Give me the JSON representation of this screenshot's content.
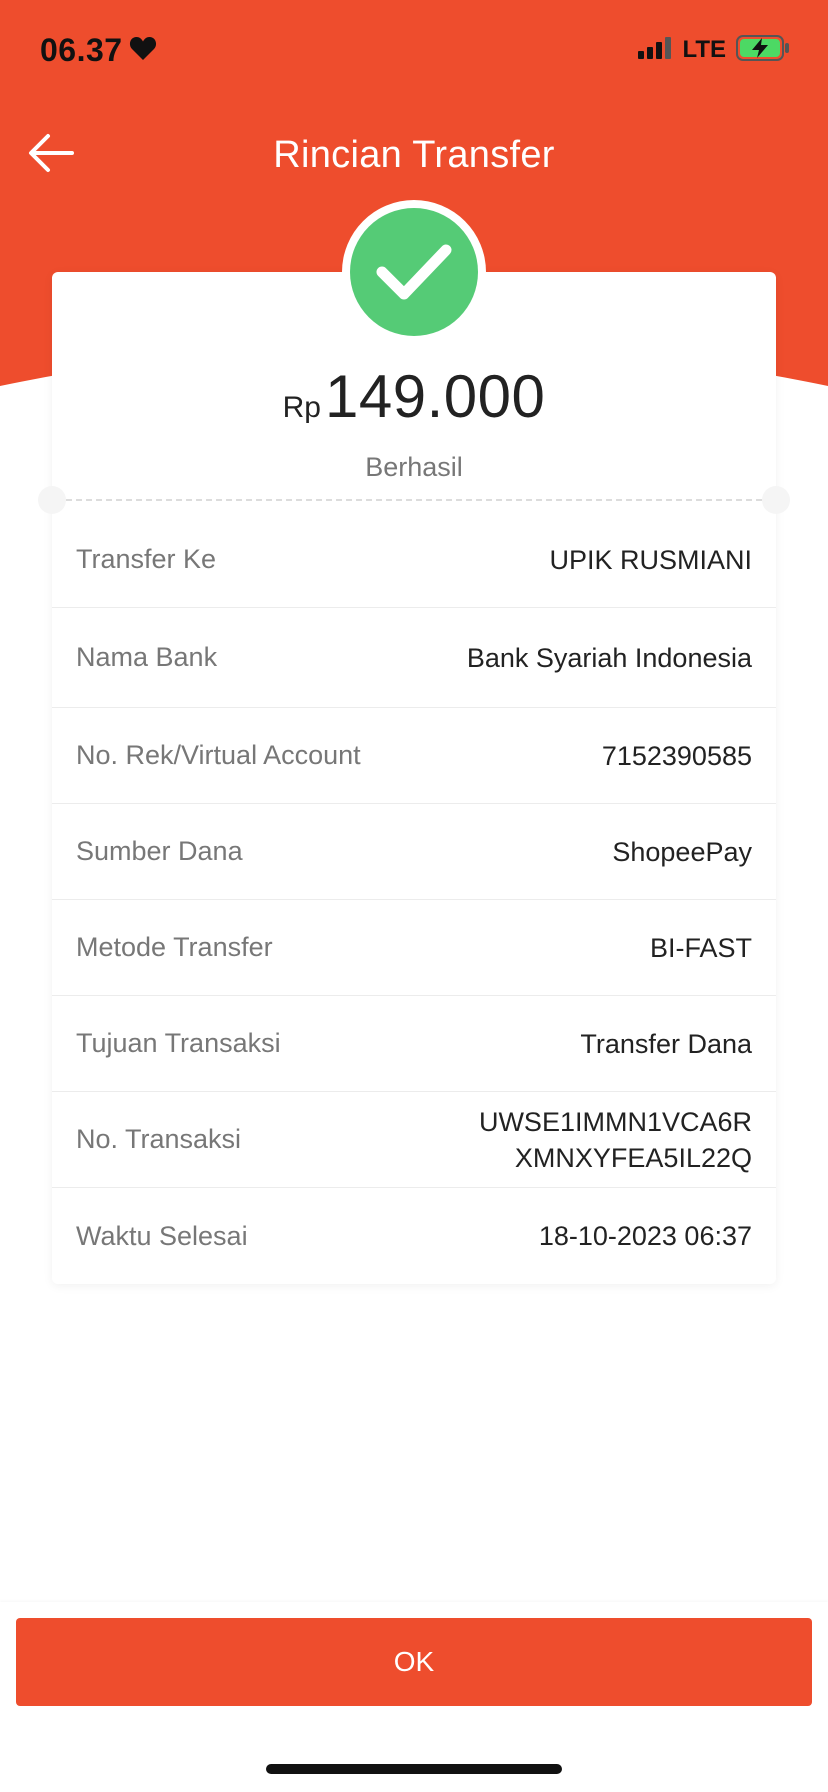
{
  "status_bar": {
    "time": "06.37",
    "network": "LTE"
  },
  "header": {
    "title": "Rincian Transfer",
    "back_icon": "arrow-left-icon"
  },
  "summary": {
    "currency": "Rp",
    "amount": "149.000",
    "status": "Berhasil",
    "status_icon": "check-icon"
  },
  "details": [
    {
      "label": "Transfer Ke",
      "value": "UPIK RUSMIANI"
    },
    {
      "label": "Nama Bank",
      "value": "Bank Syariah Indonesia"
    },
    {
      "label": "No. Rek/Virtual Account",
      "value": "7152390585"
    },
    {
      "label": "Sumber Dana",
      "value": "ShopeePay"
    },
    {
      "label": "Metode Transfer",
      "value": "BI-FAST"
    },
    {
      "label": "Tujuan Transaksi",
      "value": "Transfer Dana"
    },
    {
      "label": "No. Transaksi",
      "value": "UWSE1IMMN1VCA6R",
      "value_line2": "XMNXYFEA5IL22Q"
    },
    {
      "label": "Waktu Selesai",
      "value": "18-10-2023 06:37"
    }
  ],
  "footer": {
    "ok_label": "OK"
  },
  "colors": {
    "primary": "#ee4d2d",
    "success": "#55cb76"
  }
}
